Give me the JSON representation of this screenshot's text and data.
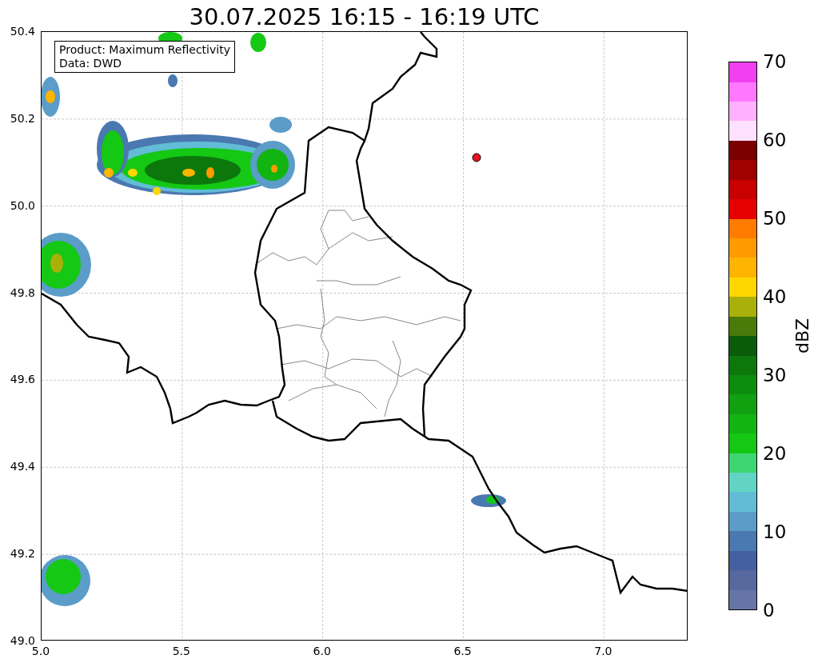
{
  "title": "30.07.2025 16:15 - 16:19 UTC",
  "annotation": [
    "Product: Maximum Reflectivity",
    "Data: DWD"
  ],
  "map": {
    "xticks": [
      "5.0",
      "5.5",
      "6.0",
      "6.5",
      "7.0"
    ],
    "yticks": [
      "50.4",
      "50.2",
      "50.0",
      "49.8",
      "49.6",
      "49.4",
      "49.2",
      "49.0"
    ]
  },
  "colorbar": {
    "label": "dBZ",
    "ticks": [
      "70",
      "60",
      "50",
      "40",
      "30",
      "20",
      "10",
      "0"
    ],
    "bands": [
      {
        "color": "#6675a5"
      },
      {
        "color": "#56689e"
      },
      {
        "color": "#4560a0"
      },
      {
        "color": "#4a78b0"
      },
      {
        "color": "#5b9dc8"
      },
      {
        "color": "#62bcd6"
      },
      {
        "color": "#62d4c4"
      },
      {
        "color": "#3ed672"
      },
      {
        "color": "#14c814"
      },
      {
        "color": "#12b412"
      },
      {
        "color": "#10a010"
      },
      {
        "color": "#0e8c0e"
      },
      {
        "color": "#0c780c"
      },
      {
        "color": "#0a5c0a"
      },
      {
        "color": "#4a7a0a"
      },
      {
        "color": "#aab00a"
      },
      {
        "color": "#ffd700"
      },
      {
        "color": "#ffb400"
      },
      {
        "color": "#ff9a00"
      },
      {
        "color": "#ff7c00"
      },
      {
        "color": "#e60000"
      },
      {
        "color": "#c80000"
      },
      {
        "color": "#a00000"
      },
      {
        "color": "#7a0000"
      },
      {
        "color": "#ffe0ff"
      },
      {
        "color": "#ffb0ff"
      },
      {
        "color": "#ff78ff"
      },
      {
        "color": "#f040f0"
      }
    ]
  }
}
